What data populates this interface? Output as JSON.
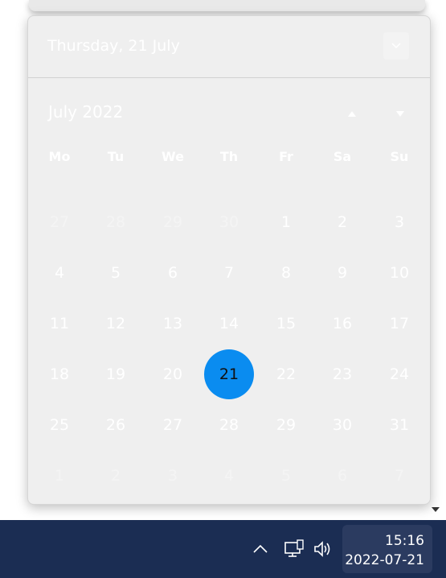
{
  "flyout": {
    "date_header": "Thursday, 21 July",
    "month_title": "July 2022",
    "weekdays": [
      "Mo",
      "Tu",
      "We",
      "Th",
      "Fr",
      "Sa",
      "Su"
    ],
    "weeks": [
      [
        "27",
        "28",
        "29",
        "30",
        "1",
        "2",
        "3"
      ],
      [
        "4",
        "5",
        "6",
        "7",
        "8",
        "9",
        "10"
      ],
      [
        "11",
        "12",
        "13",
        "14",
        "15",
        "16",
        "17"
      ],
      [
        "18",
        "19",
        "20",
        "21",
        "22",
        "23",
        "24"
      ],
      [
        "25",
        "26",
        "27",
        "28",
        "29",
        "30",
        "31"
      ],
      [
        "1",
        "2",
        "3",
        "4",
        "5",
        "6",
        "7"
      ]
    ],
    "selected_day": "21",
    "accent_color": "#0a8cf0"
  },
  "taskbar": {
    "time": "15:16",
    "date": "2022-07-21",
    "icons": [
      "chevron-up-icon",
      "network-icon",
      "volume-icon"
    ],
    "background_color": "#1b2d53"
  }
}
